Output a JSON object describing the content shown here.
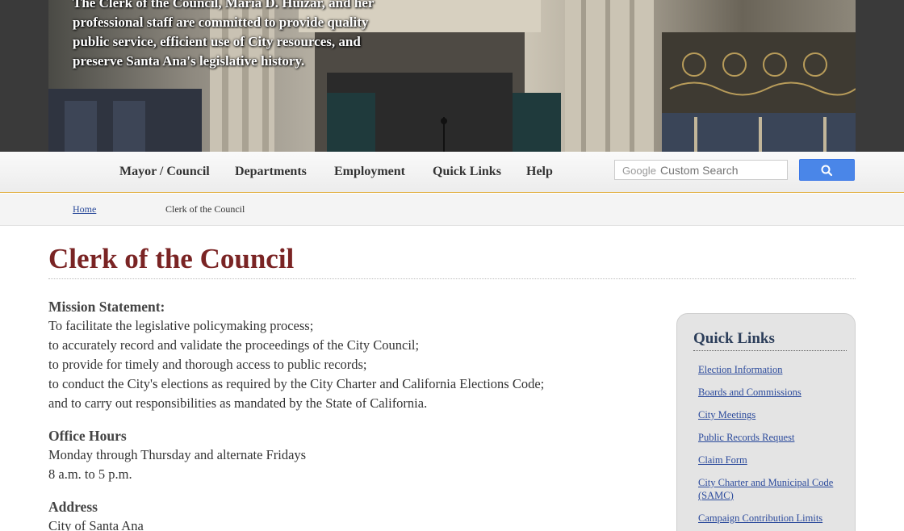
{
  "banner": {
    "text": "The Clerk of the Council, Maria D. Huizar, and her professional staff are committed to provide quality public service, efficient use of City resources, and preserve Santa Ana's legislative history."
  },
  "nav": {
    "items": [
      "Mayor / Council",
      "Departments",
      "Employment",
      "Quick Links",
      "Help"
    ]
  },
  "search": {
    "brand": "Google",
    "placeholder": "Custom Search",
    "button_icon": "search-icon"
  },
  "breadcrumb": {
    "home": "Home",
    "current": "Clerk of the Council"
  },
  "page": {
    "title": "Clerk of the Council"
  },
  "mission": {
    "heading": "Mission Statement:",
    "lines": [
      "To facilitate the legislative policymaking process;",
      "to accurately record and validate the proceedings of the City Council;",
      "to provide for timely and thorough access to public records;",
      "to conduct the City's elections as required by the City Charter and California Elections Code;",
      "and to carry out responsibilities as mandated by the State of California."
    ]
  },
  "hours": {
    "heading": "Office Hours",
    "lines": [
      "Monday through Thursday and alternate Fridays",
      "8 a.m. to 5 p.m."
    ]
  },
  "address": {
    "heading": "Address",
    "lines": [
      "City of Santa Ana"
    ]
  },
  "quick_links": {
    "title": "Quick Links",
    "items": [
      "Election Information",
      "Boards and Commissions",
      "City Meetings",
      "Public Records Request",
      "Claim Form",
      "City Charter and Municipal Code (SAMC)",
      "Campaign Contribution Limits"
    ]
  },
  "colors": {
    "title": "#7a2424",
    "link": "#2b4a9c",
    "search_button": "#4a86e8",
    "nav_border": "#e3b34a"
  }
}
